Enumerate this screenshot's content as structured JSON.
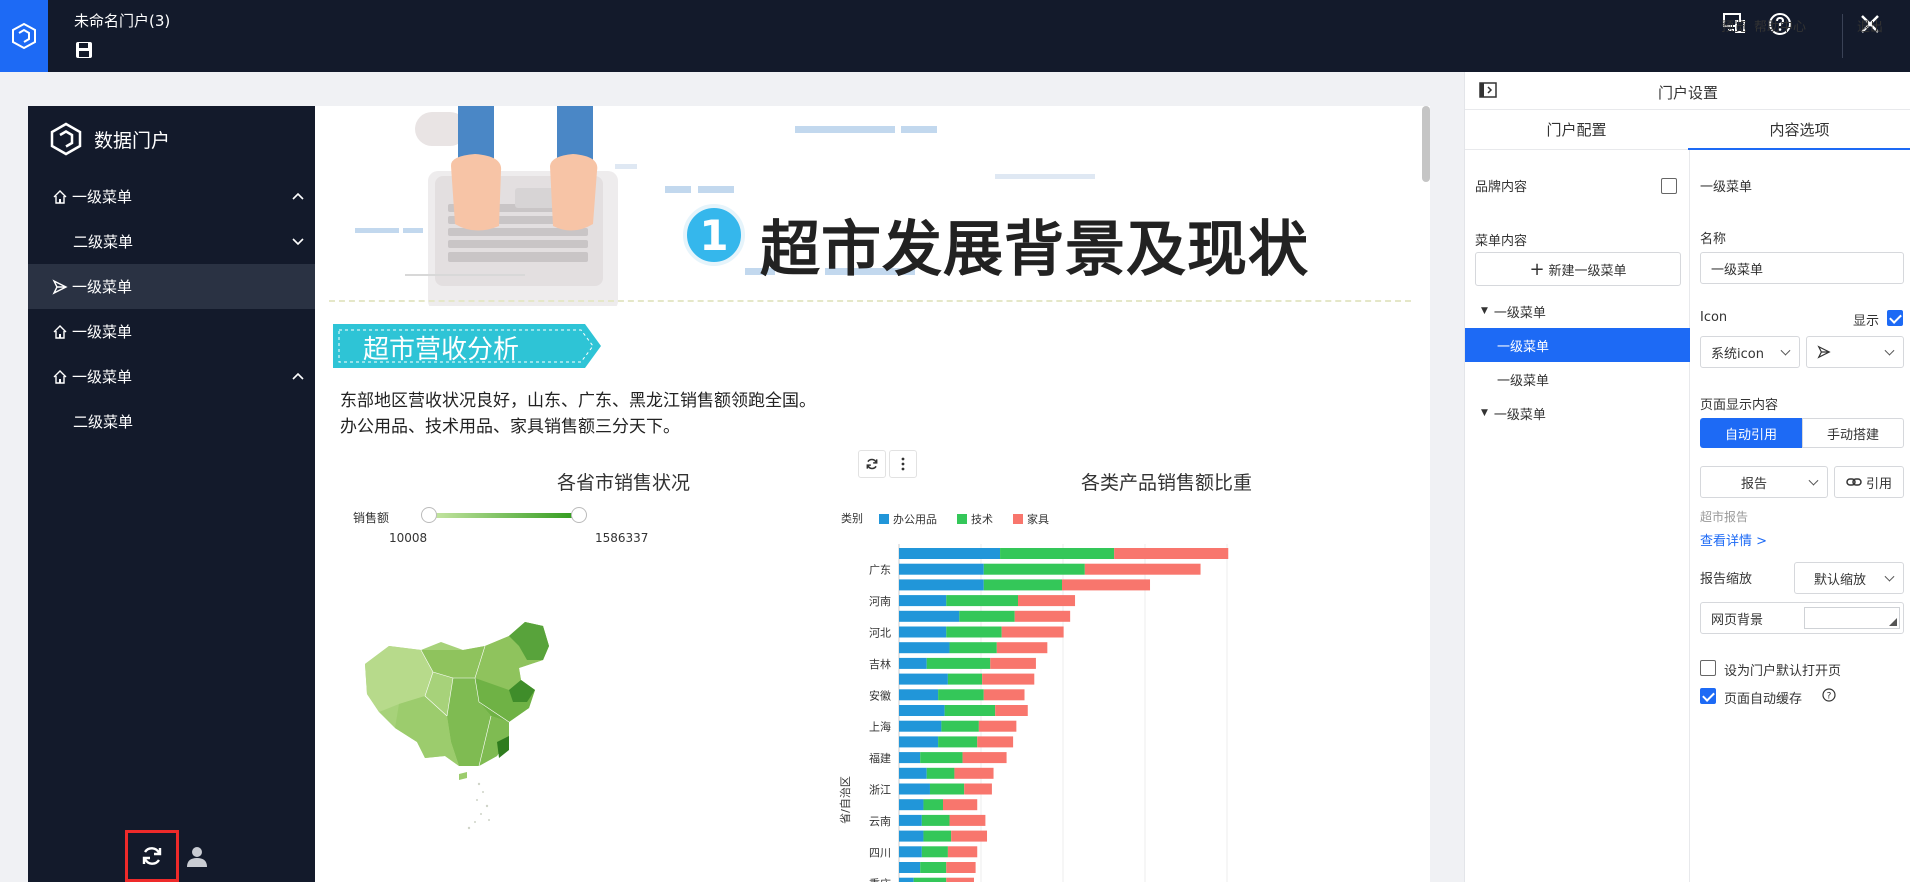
{
  "topbar": {
    "title": "未命名门户(3)",
    "preview_label": "预览",
    "help_label": "帮助中心",
    "exit_label": "退出"
  },
  "portal": {
    "brand": "数据门户",
    "menu": [
      {
        "label": "一级菜单",
        "level": 1,
        "icon": "home-icon",
        "chevron": "up"
      },
      {
        "label": "二级菜单",
        "level": 2,
        "chevron": "down"
      },
      {
        "label": "一级菜单",
        "level": 1,
        "icon": "send-icon",
        "active": true
      },
      {
        "label": "一级菜单",
        "level": 1,
        "icon": "home-icon"
      },
      {
        "label": "一级菜单",
        "level": 1,
        "icon": "home-icon",
        "chevron": "up"
      },
      {
        "label": "二级菜单",
        "level": 2
      }
    ]
  },
  "report": {
    "section_number": "1",
    "hero_title": "超市发展背景及现状",
    "subheading": "超市营收分析",
    "desc_line1": "东部地区营收状况良好，山东、广东、黑龙江销售额领跑全国。",
    "desc_line2": "办公用品、技术用品、家具销售额三分天下。",
    "map": {
      "title": "各省市销售状况",
      "legend_label": "销售额",
      "min": "10008",
      "max": "1586337"
    }
  },
  "chart_data": {
    "type": "bar",
    "orientation": "horizontal",
    "stacked": true,
    "title": "各类产品销售额比重",
    "legend_title": "类别",
    "ylabel": "省/自治区",
    "categories": [
      "",
      "广东",
      "",
      "河南",
      "",
      "河北",
      "",
      "吉林",
      "",
      "安徽",
      "",
      "上海",
      "",
      "福建",
      "",
      "浙江",
      "",
      "云南",
      "",
      "四川",
      "",
      "重庆"
    ],
    "series": [
      {
        "name": "办公用品",
        "color": "#2196d9",
        "values": [
          62,
          52,
          52,
          29,
          37,
          29,
          31,
          17,
          30,
          24,
          28,
          26,
          24,
          13,
          17,
          19,
          15,
          14,
          15,
          14,
          13,
          9
        ]
      },
      {
        "name": "技术",
        "color": "#34c759",
        "values": [
          70,
          62,
          48,
          44,
          34,
          34,
          29,
          39,
          21,
          28,
          31,
          23,
          24,
          26,
          17,
          21,
          12,
          17,
          17,
          16,
          16,
          20
        ]
      },
      {
        "name": "家具",
        "color": "#f8766d",
        "values": [
          70,
          71,
          54,
          35,
          34,
          38,
          31,
          28,
          32,
          25,
          20,
          23,
          22,
          27,
          24,
          17,
          21,
          22,
          22,
          18,
          18,
          17
        ]
      }
    ]
  },
  "settings": {
    "panel_title": "门户设置",
    "tabs": [
      "门户配置",
      "内容选项"
    ],
    "brand_content_label": "品牌内容",
    "menu_content_label": "菜单内容",
    "new_menu_button": "新建一级菜单",
    "tree": [
      {
        "label": "一级菜单",
        "expandable": true
      },
      {
        "label": "一级菜单",
        "selected": true
      },
      {
        "label": "一级菜单"
      },
      {
        "label": "一级菜单",
        "expandable": true
      }
    ],
    "section_title": "一级菜单",
    "name_label": "名称",
    "name_value": "一级菜单",
    "icon_label": "Icon",
    "show_label": "显示",
    "icon_type": "系统icon",
    "page_content_label": "页面显示内容",
    "seg_auto": "自动引用",
    "seg_manual": "手动搭建",
    "report_select": "报告",
    "ref_button": "引用",
    "report_name": "超市报告",
    "view_details": "查看详情 >",
    "zoom_label": "报告缩放",
    "zoom_value": "默认缩放",
    "bg_label": "网页背景",
    "default_open_label": "设为门户默认打开页",
    "autosave_label": "页面自动缓存"
  }
}
